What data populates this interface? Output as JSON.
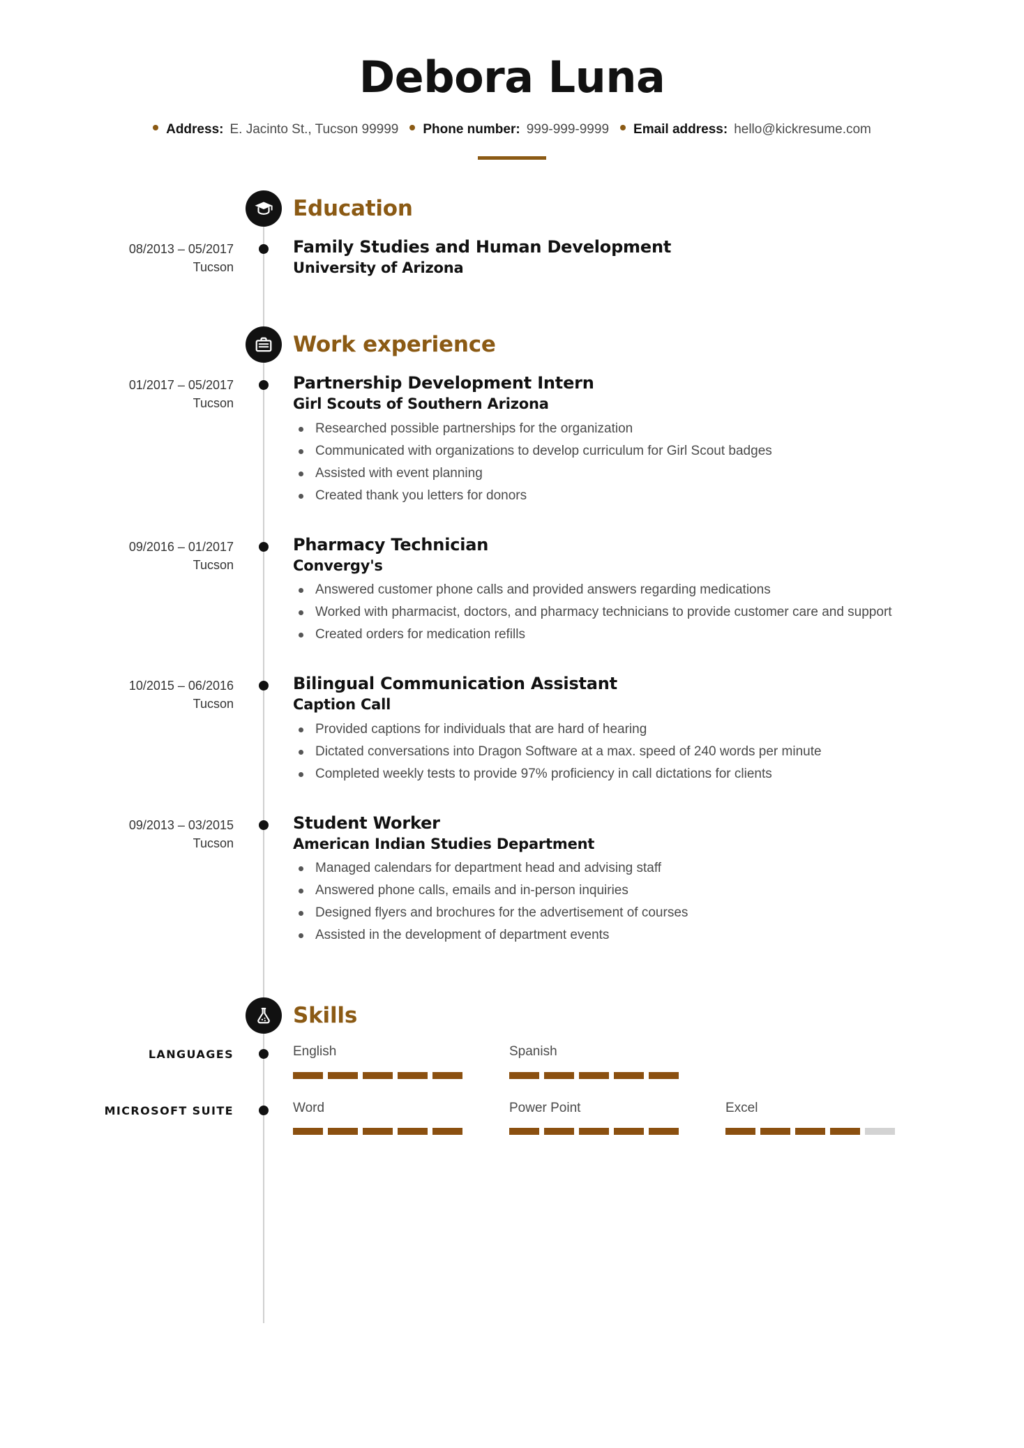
{
  "header": {
    "name": "Debora Luna",
    "contacts": [
      {
        "label": "Address:",
        "value": "E. Jacinto St., Tucson 99999"
      },
      {
        "label": "Phone number:",
        "value": "999-999-9999"
      },
      {
        "label": "Email address:",
        "value": "hello@kickresume.com"
      }
    ]
  },
  "accent_color": "#8B5A14",
  "bar_color": "#8B5010",
  "bar_empty_color": "#d3d3d3",
  "education": {
    "title": "Education",
    "icon": "graduation-cap-icon",
    "entries": [
      {
        "date": "08/2013 – 05/2017",
        "place": "Tucson",
        "title": "Family Studies and Human Development",
        "org": "University of Arizona",
        "bullets": []
      }
    ]
  },
  "work": {
    "title": "Work experience",
    "icon": "briefcase-icon",
    "entries": [
      {
        "date": "01/2017 – 05/2017",
        "place": "Tucson",
        "title": "Partnership Development Intern",
        "org": "Girl Scouts of Southern Arizona",
        "bullets": [
          "Researched possible partnerships for the organization",
          "Communicated with organizations to develop curriculum for Girl Scout badges",
          "Assisted with event planning",
          "Created thank you letters for donors"
        ]
      },
      {
        "date": "09/2016 – 01/2017",
        "place": "Tucson",
        "title": "Pharmacy Technician",
        "org": "Convergy's",
        "bullets": [
          "Answered customer phone calls and provided answers regarding medications",
          "Worked with pharmacist, doctors, and pharmacy technicians to provide customer care and support",
          "Created orders for medication refills"
        ]
      },
      {
        "date": "10/2015 – 06/2016",
        "place": "Tucson",
        "title": "Bilingual Communication Assistant",
        "org": "Caption Call",
        "bullets": [
          "Provided captions for individuals that are hard of hearing",
          "Dictated conversations into Dragon Software at a max. speed of 240 words per minute",
          "Completed weekly tests to provide 97% proficiency in call dictations for clients"
        ]
      },
      {
        "date": "09/2013 – 03/2015",
        "place": "Tucson",
        "title": "Student Worker",
        "org": "American Indian Studies Department",
        "bullets": [
          "Managed calendars for department head and advising staff",
          "Answered phone calls, emails and in-person inquiries",
          "Designed flyers and brochures for the advertisement of courses",
          "Assisted in the development of department events"
        ]
      }
    ]
  },
  "skills": {
    "title": "Skills",
    "icon": "flask-icon",
    "max_level": 5,
    "groups": [
      {
        "label": "LANGUAGES",
        "items": [
          {
            "name": "English",
            "level": 5
          },
          {
            "name": "Spanish",
            "level": 5
          }
        ]
      },
      {
        "label": "MICROSOFT SUITE",
        "items": [
          {
            "name": "Word",
            "level": 5
          },
          {
            "name": "Power Point",
            "level": 5
          },
          {
            "name": "Excel",
            "level": 4
          }
        ]
      }
    ]
  }
}
